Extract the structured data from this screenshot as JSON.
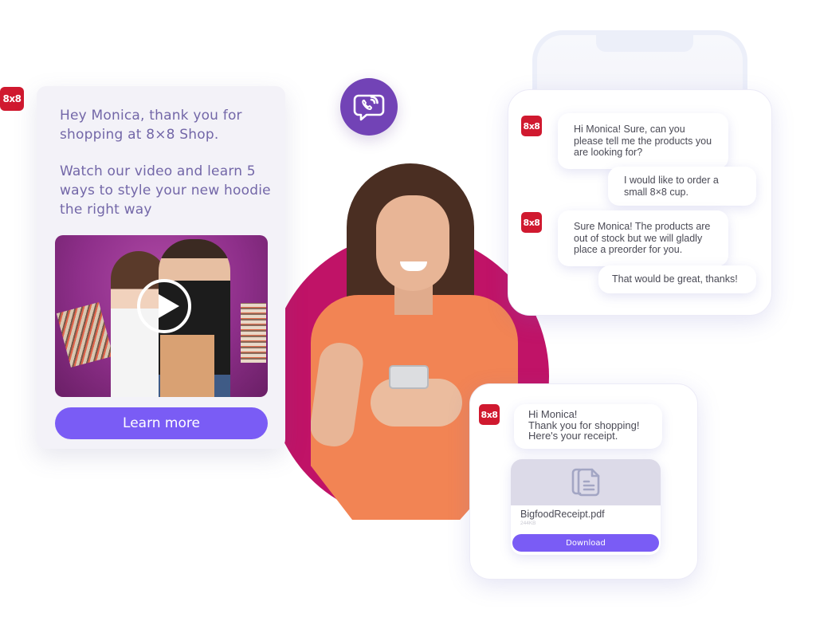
{
  "brand": {
    "badge_label": "8x8",
    "badge_color": "#d0192f",
    "accent_color": "#7a5cf5",
    "hero_color": "#c01367",
    "viber_color": "#7243b6"
  },
  "promo": {
    "message_lines": [
      "Hey Monica, thank you for shopping at 8×8 Shop.",
      "Watch our video and learn 5 ways to style your new hoodie the right way"
    ],
    "video": {
      "icon": "play-icon"
    },
    "cta_label": "Learn more"
  },
  "channel": {
    "icon": "viber-icon"
  },
  "chat": {
    "messages": [
      {
        "sender": "agent",
        "text": "Hi Monica! Sure, can you please tell me the products you are looking for?"
      },
      {
        "sender": "user",
        "text": "I would like to order a small 8×8 cup."
      },
      {
        "sender": "agent",
        "text": "Sure Monica! The products are out of stock but we will gladly place a preorder for you."
      },
      {
        "sender": "user",
        "text": "That would be great, thanks!"
      }
    ]
  },
  "receipt": {
    "message": "Hi Monica!\nThank you for shopping!\nHere's your receipt.",
    "file": {
      "name": "BigfoodReceipt.pdf",
      "size": "244KB",
      "icon": "document-icon"
    },
    "download_label": "Download"
  }
}
